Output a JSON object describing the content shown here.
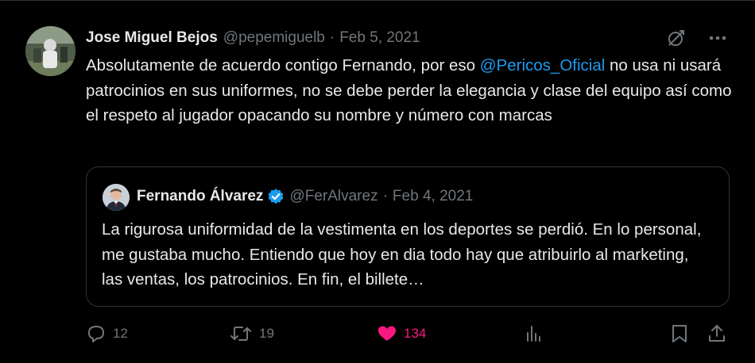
{
  "tweet": {
    "author": {
      "name": "Jose Miguel Bejos",
      "handle": "@pepemiguelb",
      "date": "Feb 5, 2021"
    },
    "separator": "·",
    "text_before_mention": "Absolutamente de acuerdo contigo Fernando, por eso ",
    "mention": "@Pericos_Oficial",
    "text_after_mention": " no usa ni usará patrocinios en sus uniformes, no se debe perder la elegancia y clase del equipo así como el respeto al jugador opacando su nombre y número con marcas",
    "icons": {
      "grok": "grok-icon",
      "more": "more-dots-icon"
    }
  },
  "quote": {
    "author": {
      "name": "Fernando Álvarez",
      "handle": "@FerAlvarez",
      "date": "Feb 4, 2021",
      "verified_icon": "verified-badge-icon"
    },
    "text": "La rigurosa uniformidad de la vestimenta en los deportes se perdió. En lo personal, me gustaba mucho. Entiendo que hoy en dia todo hay que atribuirlo al marketing, las ventas, los patrocinios. En fin, el billete…"
  },
  "actions": {
    "reply": {
      "icon": "reply-icon",
      "count": "12"
    },
    "retweet": {
      "icon": "retweet-icon",
      "count": "19"
    },
    "like": {
      "icon": "heart-filled-icon",
      "count": "134"
    },
    "views": {
      "icon": "views-icon"
    },
    "bookmark": {
      "icon": "bookmark-icon"
    },
    "share": {
      "icon": "share-icon"
    }
  },
  "colors": {
    "background": "#000000",
    "text": "#e7e9ea",
    "muted": "#71767b",
    "accent": "#1d9bf0",
    "like": "#f91880",
    "border": "#2f3336"
  }
}
